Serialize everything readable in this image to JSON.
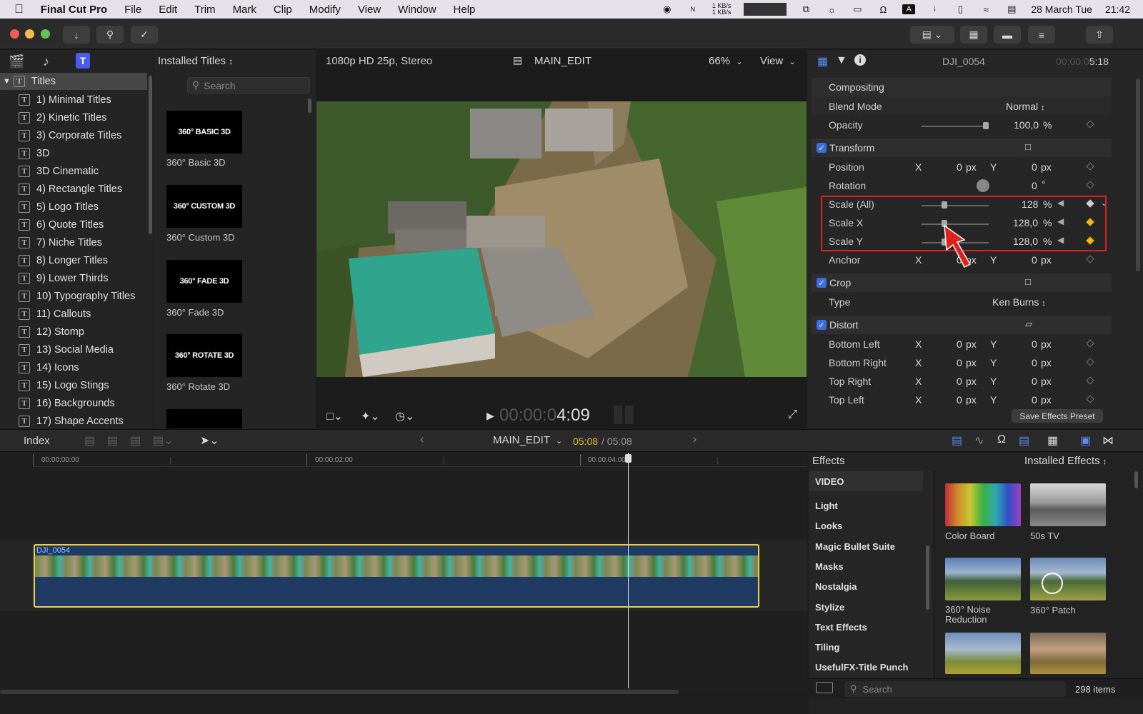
{
  "menubar": {
    "app": "Final Cut Pro",
    "items": [
      "File",
      "Edit",
      "Trim",
      "Mark",
      "Clip",
      "Modify",
      "View",
      "Window",
      "Help"
    ],
    "net_up": "1 KB/s",
    "net_down": "1 KB/s",
    "date": "28 March Tue",
    "time": "21:42"
  },
  "browser": {
    "sidebar_root": "Titles",
    "sidebar_items": [
      "1) Minimal Titles",
      "2) Kinetic Titles",
      "3) Corporate Titles",
      "3D",
      "3D Cinematic",
      "4) Rectangle Titles",
      "5) Logo Titles",
      "6) Quote Titles",
      "7) Niche Titles",
      "8) Longer Titles",
      "9) Lower Thirds",
      "10) Typography Titles",
      "11) Callouts",
      "12) Stomp",
      "13) Social Media",
      "14) Icons",
      "15) Logo Stings",
      "16) Backgrounds",
      "17) Shape Accents"
    ],
    "collection": "Installed Titles",
    "search_placeholder": "Search",
    "titles": [
      {
        "thumb": "360° BASIC 3D",
        "label": "360° Basic 3D"
      },
      {
        "thumb": "360° CUSTOM 3D",
        "label": "360° Custom 3D"
      },
      {
        "thumb": "360° FADE 3D",
        "label": "360° Fade 3D"
      },
      {
        "thumb": "360° ROTATE 3D",
        "label": "360° Rotate 3D"
      }
    ]
  },
  "viewer": {
    "format": "1080p HD 25p, Stereo",
    "project": "MAIN_EDIT",
    "zoom": "66%",
    "view_label": "View",
    "timecode_dim": "00:00:0",
    "timecode_bright": "4:09"
  },
  "inspector": {
    "clip_name": "DJI_0054",
    "duration_dim": "00:00:0",
    "duration_bright": "5:18",
    "compositing": "Compositing",
    "blend_mode_label": "Blend Mode",
    "blend_mode_value": "Normal",
    "opacity_label": "Opacity",
    "opacity_value": "100,0",
    "transform": "Transform",
    "position_label": "Position",
    "rotation_label": "Rotation",
    "rotation_value": "0",
    "scale_all_label": "Scale (All)",
    "scale_all_value": "128",
    "scale_x_label": "Scale X",
    "scale_x_value": "128,0",
    "scale_y_label": "Scale Y",
    "scale_y_value": "128,0",
    "anchor_label": "Anchor",
    "crop": "Crop",
    "type_label": "Type",
    "type_value": "Ken Burns",
    "distort": "Distort",
    "bottom_left": "Bottom Left",
    "bottom_right": "Bottom Right",
    "top_right": "Top Right",
    "top_left": "Top Left",
    "x": "X",
    "y": "Y",
    "zero": "0",
    "px": "px",
    "pct": "%",
    "deg": "°",
    "save_preset": "Save Effects Preset"
  },
  "timeline": {
    "index": "Index",
    "project": "MAIN_EDIT",
    "current": "05:08",
    "total": "/ 05:08",
    "ruler": [
      "00:00:00:00",
      "00:00:02:00",
      "00:00:04:00"
    ],
    "clip_name": "DJI_0054"
  },
  "effects": {
    "title": "Effects",
    "collection": "Installed Effects",
    "categories": [
      "VIDEO",
      "Light",
      "Looks",
      "Magic Bullet Suite",
      "Masks",
      "Nostalgia",
      "Stylize",
      "Text Effects",
      "Tiling",
      "UsefulFX-Title Punch"
    ],
    "items": [
      {
        "label": "Color Board"
      },
      {
        "label": "50s TV"
      },
      {
        "label": "360° Noise Reduction"
      },
      {
        "label": "360° Patch"
      }
    ],
    "search_placeholder": "Search",
    "count": "298 items"
  },
  "colors": {
    "accent": "#3a6fe0",
    "highlight_box": "#e0201a",
    "keyframe": "#f5b800",
    "clip_border": "#f0d040",
    "clip_audio": "#1f3a63"
  }
}
